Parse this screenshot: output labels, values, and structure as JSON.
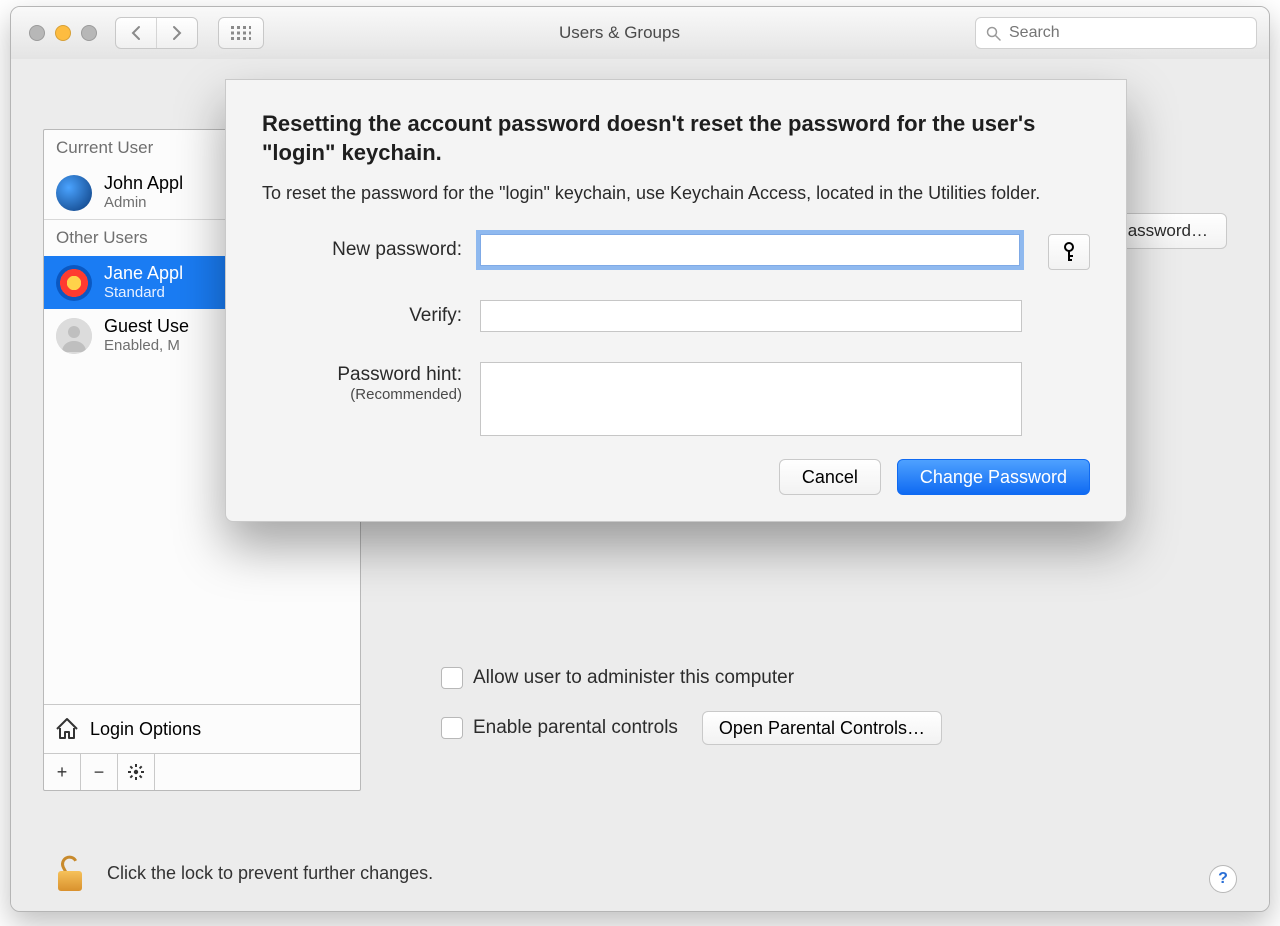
{
  "window": {
    "title": "Users & Groups"
  },
  "search": {
    "placeholder": "Search"
  },
  "sidebar": {
    "current_label": "Current User",
    "other_label": "Other Users",
    "items": [
      {
        "name": "John Appl",
        "role": "Admin"
      },
      {
        "name": "Jane Appl",
        "role": "Standard"
      },
      {
        "name": "Guest Use",
        "role": "Enabled, M"
      }
    ],
    "login_options": "Login Options"
  },
  "main": {
    "reset_button": "assword…",
    "check_admin": "Allow user to administer this computer",
    "check_parental": "Enable parental controls",
    "open_parental": "Open Parental Controls…"
  },
  "lock": {
    "text": "Click the lock to prevent further changes."
  },
  "modal": {
    "heading": "Resetting the account password doesn't reset the password for the user's \"login\" keychain.",
    "subtext": "To reset the password for the \"login\" keychain, use Keychain Access, located in the Utilities folder.",
    "new_pw_label": "New password:",
    "verify_label": "Verify:",
    "hint_label": "Password hint:",
    "hint_sub": "(Recommended)",
    "cancel": "Cancel",
    "change": "Change Password",
    "new_pw_value": "",
    "verify_value": "",
    "hint_value": ""
  }
}
